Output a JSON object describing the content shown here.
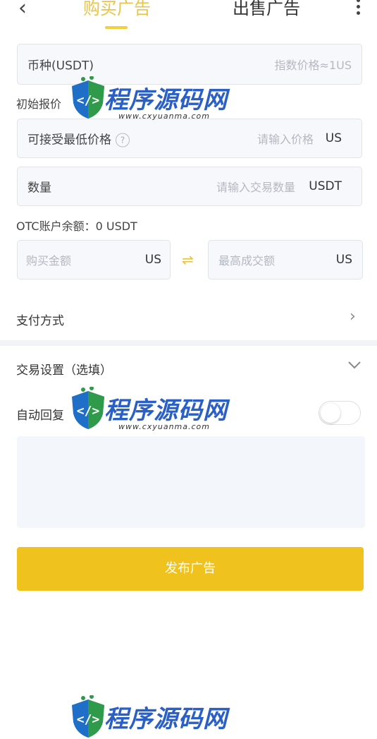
{
  "header": {
    "back_icon": "chevron-left-icon",
    "tab_buy": "购买广告",
    "tab_sell": "出售广告",
    "more_icon": "more-vertical-icon"
  },
  "currency_field": {
    "label": "币种(USDT)",
    "right_text": "指数价格≈1US"
  },
  "initial_quote_label": "初始报价",
  "min_price_field": {
    "label": "可接受最低价格",
    "help_icon": "question-icon",
    "placeholder": "请输入价格",
    "unit": "US"
  },
  "quantity_field": {
    "label": "数量",
    "placeholder": "请输入交易数量",
    "unit": "USDT"
  },
  "otc_balance": "OTC账户余额：0 USDT",
  "buy_amount": {
    "placeholder": "购买金额",
    "unit": "US"
  },
  "swap_icon": "swap-arrows-icon",
  "max_amount": {
    "placeholder": "最高成交额",
    "unit": "US"
  },
  "payment_method": {
    "label": "支付方式",
    "icon": "chevron-right-icon"
  },
  "trade_settings": {
    "label": "交易设置（选填）",
    "icon": "chevron-down-icon"
  },
  "auto_reply": {
    "label": "自动回复",
    "enabled": false
  },
  "publish_button": "发布广告",
  "watermark": {
    "text": "程序源码网",
    "url": "www.cxyuanma.com",
    "icon": "code-shield-logo"
  },
  "colors": {
    "accent": "#f0c21e",
    "tab_active": "#e8c54a",
    "field_bg": "#f6f8fb"
  }
}
